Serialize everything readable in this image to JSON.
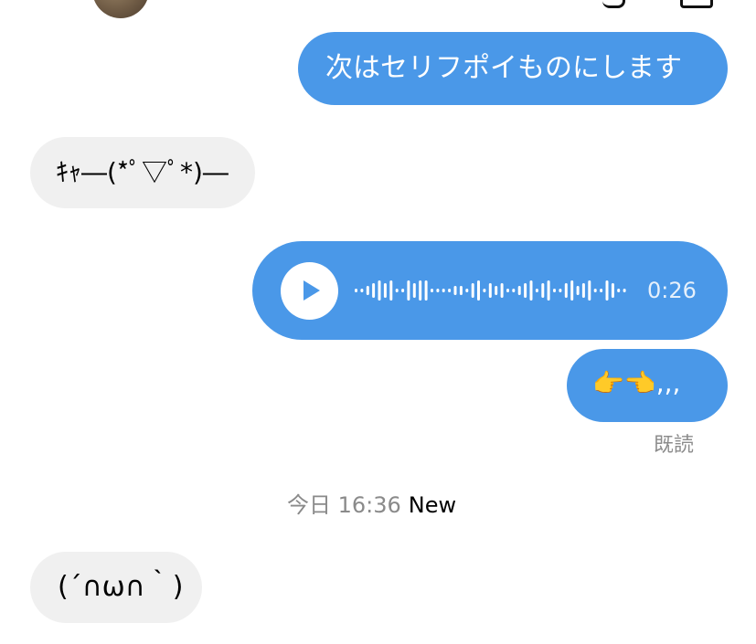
{
  "messages": [
    {
      "direction": "outgoing",
      "text": "次はセリフポイものにします"
    },
    {
      "direction": "incoming",
      "text": "ｷｬ―(*ﾟ▽ﾟ*)―"
    },
    {
      "direction": "outgoing",
      "type": "voice",
      "duration": "0:26"
    },
    {
      "direction": "outgoing",
      "text": "👉👈,,,"
    },
    {
      "direction": "incoming",
      "text": "(´∩ω∩｀)"
    }
  ],
  "read_receipt": "既読",
  "date_separator": {
    "time": "今日 16:36",
    "new_label": "New"
  },
  "voice_waveform": [
    1,
    1,
    2,
    3,
    4,
    3,
    4,
    1,
    1,
    4,
    3,
    4,
    4,
    1,
    1,
    1,
    1,
    2,
    2,
    1,
    3,
    4,
    1,
    3,
    2,
    3,
    1,
    1,
    2,
    3,
    4,
    1,
    3,
    4,
    1,
    1,
    3,
    4,
    2,
    3,
    4,
    1,
    1,
    4,
    3,
    1,
    1
  ],
  "colors": {
    "outgoing_bubble": "#4a98e8",
    "incoming_bubble": "#f0f0f0",
    "meta_text": "#8a8a8a"
  }
}
